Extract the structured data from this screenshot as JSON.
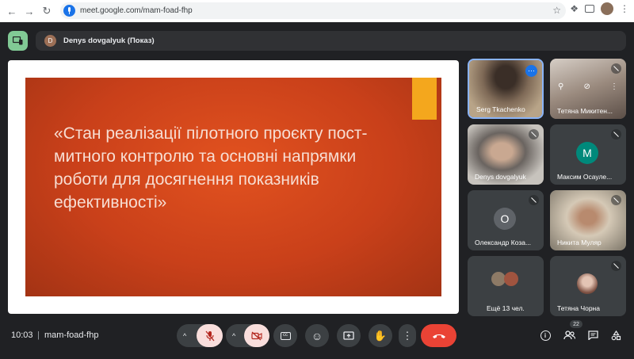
{
  "browser": {
    "url": "meet.google.com/mam-foad-fhp"
  },
  "presenting": {
    "avatar_initial": "D",
    "label": "Denys dovgalyuk (Показ)"
  },
  "slide": {
    "title": "«Стан реалізації пілотного проєкту пост-митного контролю та основні напрямки роботи для досягнення показників ефективності»"
  },
  "participants": [
    {
      "name": "Serg Tkachenko"
    },
    {
      "name": "Тетяна Микитен..."
    },
    {
      "name": "Denys dovgalyuk"
    },
    {
      "name": "Максим Осауле...",
      "initial": "M",
      "color": "#00897b"
    },
    {
      "name": "Олександр Коза...",
      "initial": "O",
      "color": "#5f6368"
    },
    {
      "name": "Никита Муляр"
    },
    {
      "name": "Ещё 13 чел."
    },
    {
      "name": "Тетяна Чорна"
    }
  ],
  "meeting": {
    "time": "10:03",
    "code": "mam-foad-fhp",
    "people_count": "22"
  },
  "colors": {
    "end_call": "#ea4335",
    "muted_bg": "#f9dedc",
    "muted_icon": "#b3261e",
    "active_border": "#8ab4f8"
  }
}
